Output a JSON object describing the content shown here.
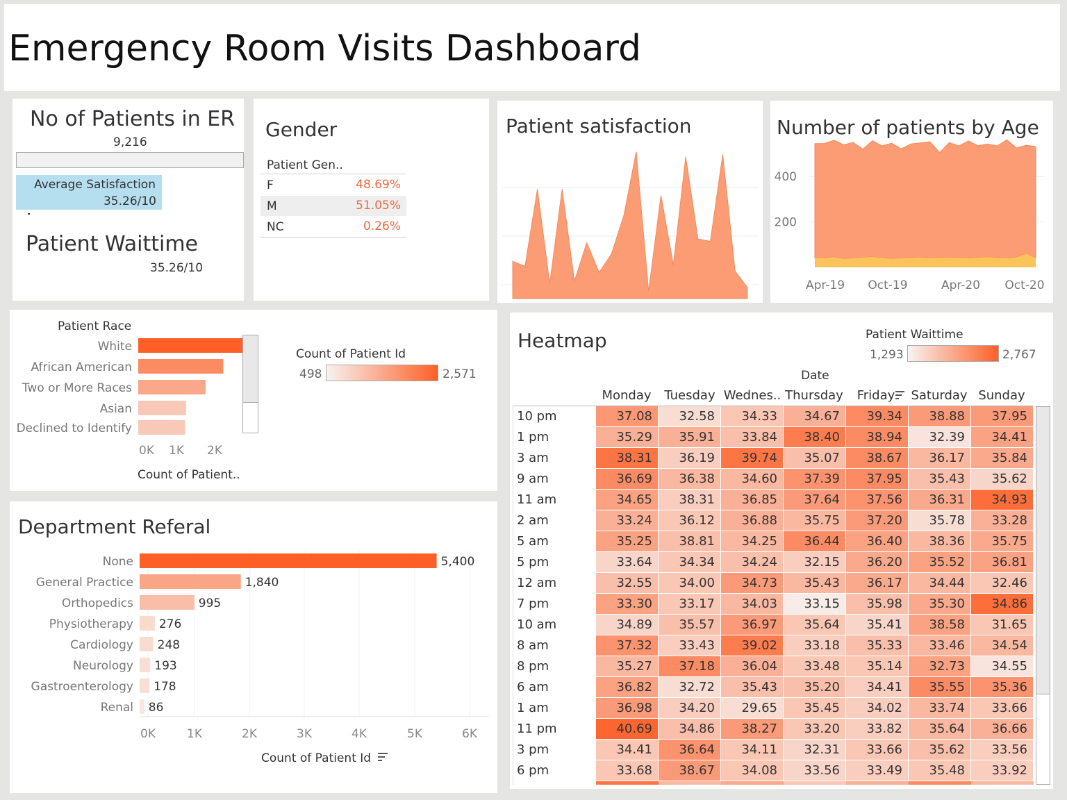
{
  "header": {
    "title": "Emergency Room Visits Dashboard"
  },
  "kpi": {
    "patients_title": "No of Patients in ER",
    "patients_value": "9,216",
    "avg_label": "Average Satisfaction",
    "avg_value": "35.26/10",
    "wait_title": "Patient Waittime",
    "wait_value": "35.26/10"
  },
  "gender": {
    "title": "Gender",
    "column_header": "Patient Gen..",
    "rows": [
      {
        "label": "F",
        "value": "48.69%"
      },
      {
        "label": "M",
        "value": "51.05%"
      },
      {
        "label": "NC",
        "value": "0.26%"
      }
    ]
  },
  "satisfaction": {
    "title": "Patient satisfaction"
  },
  "age": {
    "title": "Number of patients by Age"
  },
  "race": {
    "header": "Patient Race",
    "axis_title": "Count of Patient..",
    "legend_title": "Count of Patient Id",
    "legend_min": "498",
    "legend_max": "2,571"
  },
  "department": {
    "title": "Department Referal",
    "axis_title": "Count of Patient Id"
  },
  "heatmap": {
    "title": "Heatmap",
    "legend_title": "Patient Waittime",
    "legend_min": "1,293",
    "legend_max": "2,767",
    "col_header": "Date"
  },
  "colors": {
    "accent": "#fe5f27",
    "mid": "#f9a47e",
    "light": "#f9e8df",
    "yellow": "#fbc45b",
    "avg_bg": "#b5dfef"
  },
  "chart_data": [
    {
      "type": "area",
      "name": "satisfaction",
      "values": [
        3.0,
        2.6,
        8.8,
        1.2,
        8.8,
        1.4,
        4.5,
        2.1,
        3.6,
        6.7,
        11.8,
        0.6,
        8.3,
        2.7,
        11.4,
        4.8,
        4.6,
        11.6,
        2.2,
        0.9
      ],
      "ylim": [
        0,
        12
      ],
      "grid": true
    },
    {
      "type": "area",
      "name": "age",
      "x_ticks": [
        "Apr-19",
        "Oct-19",
        "Apr-20",
        "Oct-20"
      ],
      "y_ticks": [
        200,
        400
      ],
      "ylim": [
        0,
        520
      ],
      "series": [
        {
          "values": [
            65,
            63,
            68,
            62,
            60,
            66,
            70,
            65,
            62,
            60,
            68,
            64,
            60,
            66,
            62,
            65,
            68,
            70,
            64,
            60,
            62,
            66,
            68,
            64
          ]
        },
        {
          "values": [
            480,
            483,
            492,
            478,
            490,
            455,
            488,
            470,
            485,
            462,
            476,
            484,
            493,
            440,
            488,
            470,
            489,
            466,
            480,
            475,
            500,
            460,
            470,
            468
          ]
        },
        {
          "values": [
            42,
            40,
            45,
            38,
            40,
            44,
            46,
            42,
            38,
            40,
            42,
            44,
            40,
            42,
            44,
            42,
            40,
            43,
            45,
            42,
            40,
            44,
            60,
            42
          ]
        }
      ]
    },
    {
      "type": "bar",
      "name": "race",
      "categories": [
        "White",
        "African American",
        "Two or More Races",
        "Asian",
        "Declined to Identify"
      ],
      "values": [
        2571,
        1958,
        1550,
        1100,
        1080
      ],
      "x_ticks": [
        "0K",
        "1K",
        "2K"
      ],
      "xlim": [
        0,
        2800
      ]
    },
    {
      "type": "bar",
      "name": "department",
      "categories": [
        "None",
        "General Practice",
        "Orthopedics",
        "Physiotherapy",
        "Cardiology",
        "Neurology",
        "Gastroenterology",
        "Renal"
      ],
      "values": [
        5400,
        1840,
        995,
        276,
        248,
        193,
        178,
        86
      ],
      "value_labels": [
        "5,400",
        "1,840",
        "995",
        "276",
        "248",
        "193",
        "178",
        "86"
      ],
      "x_ticks": [
        "0K",
        "1K",
        "2K",
        "3K",
        "4K",
        "5K",
        "6K"
      ],
      "xlim": [
        0,
        6200
      ]
    },
    {
      "type": "heatmap",
      "name": "heatmap",
      "columns": [
        "Monday",
        "Tuesday",
        "Wednes..",
        "Thursday",
        "Friday",
        "Saturday",
        "Sunday"
      ],
      "rows": [
        "10 pm",
        "1 pm",
        "3 am",
        "9 am",
        "11 am",
        "2 am",
        "5 am",
        "5 pm",
        "12 am",
        "7 pm",
        "10 am",
        "8 am",
        "8 pm",
        "6 am",
        "1 am",
        "11 pm",
        "3 pm",
        "6 pm"
      ],
      "values": [
        [
          "37.08",
          "32.58",
          "34.33",
          "34.67",
          "39.34",
          "38.88",
          "37.95"
        ],
        [
          "35.29",
          "35.91",
          "33.84",
          "38.40",
          "38.94",
          "32.39",
          "34.41"
        ],
        [
          "38.31",
          "36.19",
          "39.74",
          "35.07",
          "38.67",
          "36.17",
          "35.84"
        ],
        [
          "36.69",
          "36.38",
          "34.60",
          "37.39",
          "37.95",
          "35.43",
          "35.62"
        ],
        [
          "34.65",
          "38.31",
          "36.85",
          "37.64",
          "37.56",
          "36.31",
          "34.93"
        ],
        [
          "33.24",
          "36.12",
          "36.88",
          "35.75",
          "37.20",
          "35.78",
          "33.28"
        ],
        [
          "35.25",
          "38.81",
          "34.25",
          "36.44",
          "36.40",
          "38.36",
          "35.75"
        ],
        [
          "33.64",
          "34.34",
          "34.24",
          "32.15",
          "36.20",
          "35.52",
          "36.81"
        ],
        [
          "32.55",
          "34.00",
          "34.73",
          "35.43",
          "36.17",
          "34.44",
          "32.46"
        ],
        [
          "33.30",
          "33.17",
          "34.03",
          "33.15",
          "35.98",
          "35.30",
          "34.86"
        ],
        [
          "34.89",
          "35.57",
          "36.97",
          "35.64",
          "35.41",
          "38.58",
          "31.65"
        ],
        [
          "37.32",
          "33.43",
          "39.02",
          "33.18",
          "35.33",
          "33.46",
          "34.54"
        ],
        [
          "35.27",
          "37.18",
          "36.04",
          "33.48",
          "35.14",
          "32.73",
          "34.55"
        ],
        [
          "36.82",
          "32.72",
          "35.43",
          "35.20",
          "34.41",
          "35.55",
          "35.36"
        ],
        [
          "36.98",
          "34.20",
          "29.65",
          "35.45",
          "34.02",
          "33.74",
          "33.66"
        ],
        [
          "40.69",
          "34.86",
          "38.27",
          "33.20",
          "33.82",
          "35.64",
          "36.66"
        ],
        [
          "34.41",
          "36.64",
          "34.11",
          "32.31",
          "33.66",
          "35.62",
          "33.56"
        ],
        [
          "33.68",
          "38.67",
          "34.08",
          "33.56",
          "33.49",
          "35.48",
          "33.92"
        ]
      ],
      "intensity": [
        [
          0.62,
          0.15,
          0.3,
          0.45,
          0.7,
          0.6,
          0.6
        ],
        [
          0.45,
          0.45,
          0.35,
          0.8,
          0.7,
          0.1,
          0.55
        ],
        [
          0.85,
          0.25,
          0.85,
          0.35,
          0.7,
          0.4,
          0.5
        ],
        [
          0.7,
          0.4,
          0.4,
          0.65,
          0.7,
          0.35,
          0.2
        ],
        [
          0.55,
          0.25,
          0.45,
          0.6,
          0.65,
          0.5,
          0.9
        ],
        [
          0.45,
          0.3,
          0.45,
          0.4,
          0.6,
          0.15,
          0.45
        ],
        [
          0.55,
          0.35,
          0.4,
          0.7,
          0.55,
          0.4,
          0.5
        ],
        [
          0.2,
          0.3,
          0.35,
          0.25,
          0.5,
          0.55,
          0.55
        ],
        [
          0.35,
          0.3,
          0.6,
          0.4,
          0.5,
          0.4,
          0.3
        ],
        [
          0.55,
          0.3,
          0.4,
          0.05,
          0.35,
          0.5,
          0.9
        ],
        [
          0.2,
          0.35,
          0.6,
          0.3,
          0.2,
          0.55,
          0.3
        ],
        [
          0.65,
          0.25,
          0.8,
          0.25,
          0.35,
          0.4,
          0.4
        ],
        [
          0.4,
          0.7,
          0.45,
          0.3,
          0.3,
          0.55,
          0.1
        ],
        [
          0.55,
          0.15,
          0.35,
          0.35,
          0.25,
          0.7,
          0.65
        ],
        [
          0.6,
          0.25,
          0.15,
          0.3,
          0.25,
          0.4,
          0.3
        ],
        [
          0.95,
          0.35,
          0.6,
          0.3,
          0.25,
          0.4,
          0.45
        ],
        [
          0.3,
          0.65,
          0.3,
          0.2,
          0.3,
          0.35,
          0.25
        ],
        [
          0.3,
          0.6,
          0.3,
          0.2,
          0.25,
          0.3,
          0.25
        ]
      ],
      "legend_title": "Patient Waittime"
    }
  ]
}
